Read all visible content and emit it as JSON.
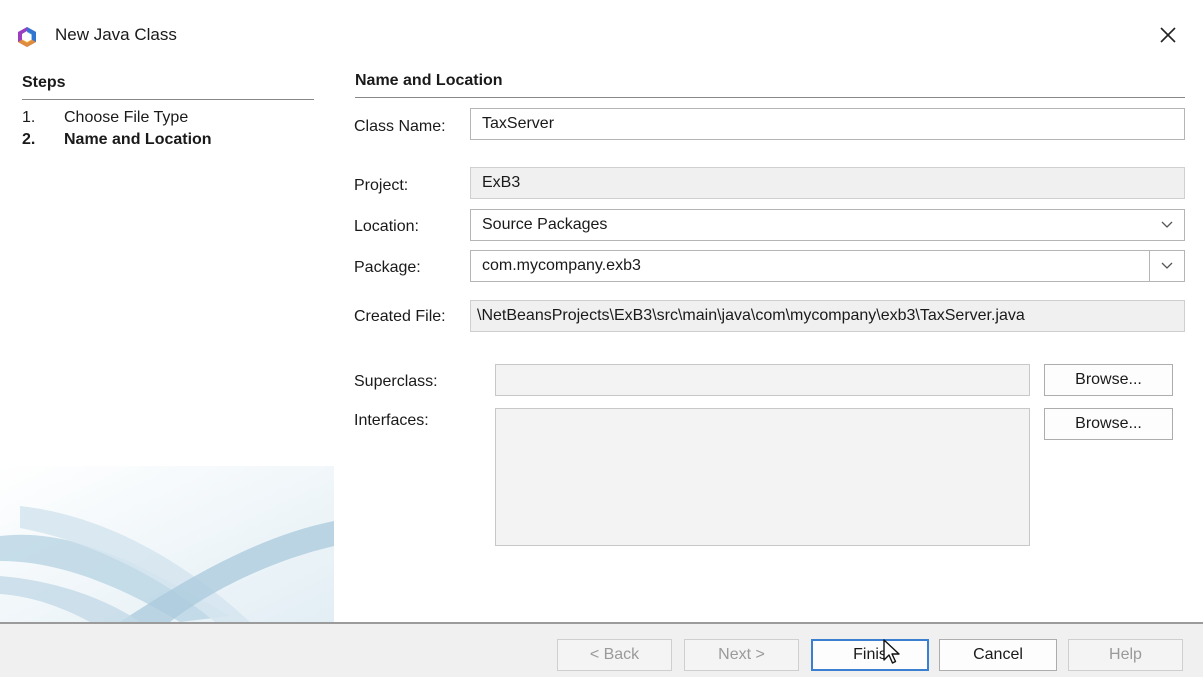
{
  "window": {
    "title": "New Java Class",
    "icon": "netbeans-cube-icon",
    "close_icon": "close-icon"
  },
  "steps": {
    "heading": "Steps",
    "items": [
      {
        "num": "1.",
        "label": "Choose File Type",
        "current": false
      },
      {
        "num": "2.",
        "label": "Name and Location",
        "current": true
      }
    ]
  },
  "form": {
    "section_title": "Name and Location",
    "class_name": {
      "label": "Class Name:",
      "value": "TaxServer"
    },
    "project": {
      "label": "Project:",
      "value": "ExB3"
    },
    "location": {
      "label": "Location:",
      "value": "Source Packages"
    },
    "package": {
      "label": "Package:",
      "value": "com.mycompany.exb3"
    },
    "created_file": {
      "label": "Created File:",
      "value": "\\NetBeansProjects\\ExB3\\src\\main\\java\\com\\mycompany\\exb3\\TaxServer.java"
    },
    "superclass": {
      "label": "Superclass:",
      "value": "",
      "browse_label": "Browse..."
    },
    "interfaces": {
      "label": "Interfaces:",
      "value": "",
      "browse_label": "Browse..."
    }
  },
  "footer": {
    "back_label": "< Back",
    "next_label": "Next >",
    "finish_label": "Finis",
    "cancel_label": "Cancel",
    "help_label": "Help"
  },
  "colors": {
    "accent": "#3b7fd1",
    "footer_bg": "#f0f0f0",
    "readonly_bg": "#f0f0f0"
  }
}
